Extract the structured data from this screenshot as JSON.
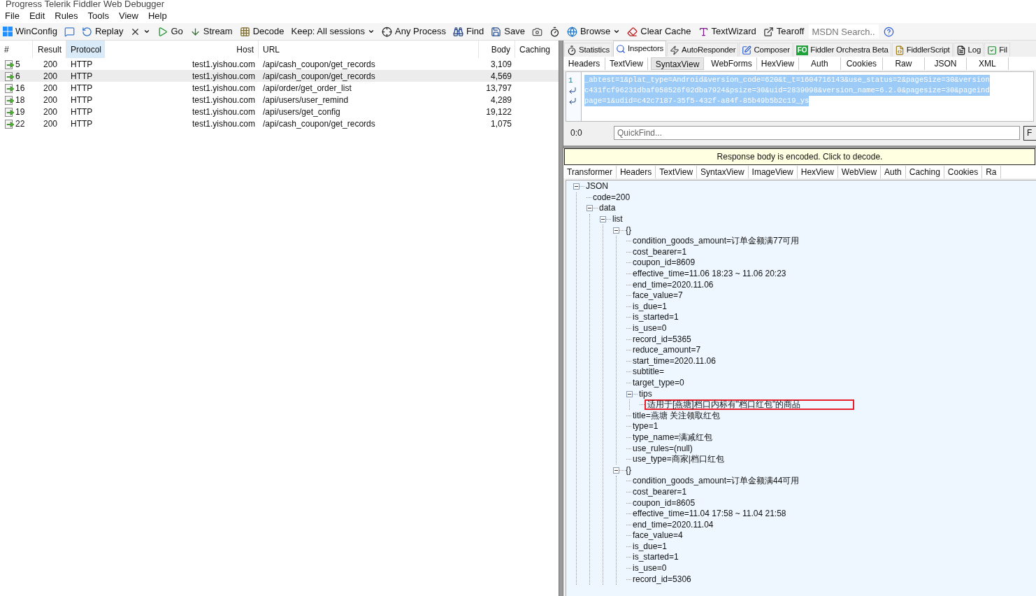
{
  "window": {
    "title": "Progress Telerik Fiddler Web Debugger"
  },
  "menu": [
    {
      "label": "File"
    },
    {
      "label": "Edit"
    },
    {
      "label": "Rules"
    },
    {
      "label": "Tools"
    },
    {
      "label": "View"
    },
    {
      "label": "Help"
    }
  ],
  "toolbar": [
    {
      "kind": "windows",
      "label": "WinConfig"
    },
    {
      "kind": "comment"
    },
    {
      "kind": "replay",
      "label": "Replay"
    },
    {
      "kind": "remove",
      "dropdown": true
    },
    {
      "kind": "go",
      "label": "Go"
    },
    {
      "kind": "stream",
      "label": "Stream"
    },
    {
      "kind": "decode",
      "label": "Decode"
    },
    {
      "kind": "keep",
      "label": "Keep: All sessions",
      "dropdown": true
    },
    {
      "kind": "process",
      "label": "Any Process"
    },
    {
      "kind": "find",
      "label": "Find"
    },
    {
      "kind": "save",
      "label": "Save"
    },
    {
      "kind": "camera"
    },
    {
      "kind": "timer"
    },
    {
      "kind": "browse",
      "label": "Browse",
      "dropdown": true
    },
    {
      "kind": "clear",
      "label": "Clear Cache"
    },
    {
      "kind": "textwizard",
      "label": "TextWizard"
    },
    {
      "kind": "tearoff",
      "label": "Tearoff"
    },
    {
      "kind": "search",
      "placeholder": "MSDN Search..."
    },
    {
      "kind": "help"
    }
  ],
  "sessions": {
    "columns": [
      {
        "label": "#",
        "sorted": false
      },
      {
        "label": "Result",
        "sorted": false
      },
      {
        "label": "Protocol",
        "sorted": true
      },
      {
        "label": "Host",
        "sorted": false
      },
      {
        "label": "URL",
        "sorted": false
      },
      {
        "label": "Body",
        "sorted": false
      },
      {
        "label": "Caching",
        "sorted": false
      }
    ],
    "rows": [
      {
        "id": "5",
        "result": "200",
        "protocol": "HTTP",
        "host": "test1.yishou.com",
        "url": "/api/cash_coupon/get_records",
        "body": "3,109",
        "selected": false
      },
      {
        "id": "6",
        "result": "200",
        "protocol": "HTTP",
        "host": "test1.yishou.com",
        "url": "/api/cash_coupon/get_records",
        "body": "4,569",
        "selected": true
      },
      {
        "id": "16",
        "result": "200",
        "protocol": "HTTP",
        "host": "test1.yishou.com",
        "url": "/api/order/get_order_list",
        "body": "13,797",
        "selected": false
      },
      {
        "id": "18",
        "result": "200",
        "protocol": "HTTP",
        "host": "test1.yishou.com",
        "url": "/api/users/user_remind",
        "body": "4,289",
        "selected": false
      },
      {
        "id": "19",
        "result": "200",
        "protocol": "HTTP",
        "host": "test1.yishou.com",
        "url": "/api/users/get_config",
        "body": "19,122",
        "selected": false
      },
      {
        "id": "22",
        "result": "200",
        "protocol": "HTTP",
        "host": "test1.yishou.com",
        "url": "/api/cash_coupon/get_records",
        "body": "1,075",
        "selected": false
      }
    ]
  },
  "top_tabs": [
    {
      "kind": "timer",
      "label": "Statistics",
      "selected": false
    },
    {
      "kind": "inspect",
      "label": "Inspectors",
      "selected": true
    },
    {
      "kind": "bolt",
      "label": "AutoResponder",
      "selected": false
    },
    {
      "kind": "compose",
      "label": "Composer",
      "selected": false
    },
    {
      "kind": "badge",
      "badge": "FO",
      "label": "Fiddler Orchestra Beta",
      "selected": false
    },
    {
      "kind": "script",
      "label": "FiddlerScript",
      "selected": false
    },
    {
      "kind": "log",
      "label": "Log",
      "selected": false
    },
    {
      "kind": "check",
      "label": "Fil",
      "selected": false
    }
  ],
  "request": {
    "tabs": [
      {
        "label": "Headers",
        "selected": false
      },
      {
        "label": "TextView",
        "selected": false
      },
      {
        "label": "SyntaxView",
        "selected": true
      },
      {
        "label": "WebForms",
        "selected": false
      },
      {
        "label": "HexView",
        "selected": false
      },
      {
        "label": "Auth",
        "selected": false
      },
      {
        "label": "Cookies",
        "selected": false
      },
      {
        "label": "Raw",
        "selected": false
      },
      {
        "label": "JSON",
        "selected": false
      },
      {
        "label": "XML",
        "selected": false
      }
    ],
    "line_number": "1",
    "lines": [
      {
        "text": "_abtest=1&plat_type=Android&version_code=620&t_t=1604716143&use_status=2&pageSize=30&version",
        "wrapped": false,
        "selected": true
      },
      {
        "text": "c431fcf96231dbaf058526f02dba7924&psize=30&uid=2839098&version_name=6.2.0&pagesize=30&pageind",
        "wrapped": true,
        "selected": true
      },
      {
        "text": "page=1&udid=c42c7187-35f5-432f-a84f-85b49b5b2c19_ys",
        "wrapped": true,
        "selected": true
      }
    ],
    "position": "0:0",
    "quickfind": {
      "placeholder": "QuickFind..."
    },
    "find_button": "F"
  },
  "response": {
    "banner": "Response body is encoded. Click to decode.",
    "tabs": [
      {
        "label": "Transformer",
        "selected": false
      },
      {
        "label": "Headers",
        "selected": false
      },
      {
        "label": "TextView",
        "selected": false
      },
      {
        "label": "SyntaxView",
        "selected": false
      },
      {
        "label": "ImageView",
        "selected": false
      },
      {
        "label": "HexView",
        "selected": false
      },
      {
        "label": "WebView",
        "selected": false
      },
      {
        "label": "Auth",
        "selected": false
      },
      {
        "label": "Caching",
        "selected": false
      },
      {
        "label": "Cookies",
        "selected": false
      },
      {
        "label": "Ra",
        "selected": false
      }
    ],
    "tree": [
      {
        "label": "JSON",
        "expanded": true,
        "children": [
          {
            "label": "code=200"
          },
          {
            "label": "data",
            "expanded": true,
            "children": [
              {
                "label": "list",
                "expanded": true,
                "children": [
                  {
                    "label": "{}",
                    "expanded": true,
                    "children": [
                      {
                        "label": "condition_goods_amount=订单金额满77可用"
                      },
                      {
                        "label": "cost_bearer=1"
                      },
                      {
                        "label": "coupon_id=8609"
                      },
                      {
                        "label": "effective_time=11.06 18:23 ~ 11.06 20:23"
                      },
                      {
                        "label": "end_time=2020.11.06"
                      },
                      {
                        "label": "face_value=7"
                      },
                      {
                        "label": "is_due=1"
                      },
                      {
                        "label": "is_started=1"
                      },
                      {
                        "label": "is_use=0"
                      },
                      {
                        "label": "record_id=5365"
                      },
                      {
                        "label": "reduce_amount=7"
                      },
                      {
                        "label": "start_time=2020.11.06"
                      },
                      {
                        "label": "subtitle="
                      },
                      {
                        "label": "target_type=0"
                      },
                      {
                        "label": "tips",
                        "expanded": true,
                        "children": [
                          {
                            "label": "适用于[燕塘]档口内标有\"档口红包\"的商品",
                            "highlighted": true
                          }
                        ]
                      },
                      {
                        "label": "title=燕塘 关注领取红包"
                      },
                      {
                        "label": "type=1"
                      },
                      {
                        "label": "type_name=满减红包"
                      },
                      {
                        "label": "use_rules=(null)"
                      },
                      {
                        "label": "use_type=商家|档口红包"
                      }
                    ]
                  },
                  {
                    "label": "{}",
                    "expanded": true,
                    "children": [
                      {
                        "label": "condition_goods_amount=订单金额满44可用"
                      },
                      {
                        "label": "cost_bearer=1"
                      },
                      {
                        "label": "coupon_id=8605"
                      },
                      {
                        "label": "effective_time=11.04 17:58 ~ 11.04 21:58"
                      },
                      {
                        "label": "end_time=2020.11.04"
                      },
                      {
                        "label": "face_value=4"
                      },
                      {
                        "label": "is_due=1"
                      },
                      {
                        "label": "is_started=1"
                      },
                      {
                        "label": "is_use=0"
                      },
                      {
                        "label": "record_id=5306"
                      }
                    ]
                  }
                ]
              }
            ]
          }
        ]
      }
    ]
  }
}
